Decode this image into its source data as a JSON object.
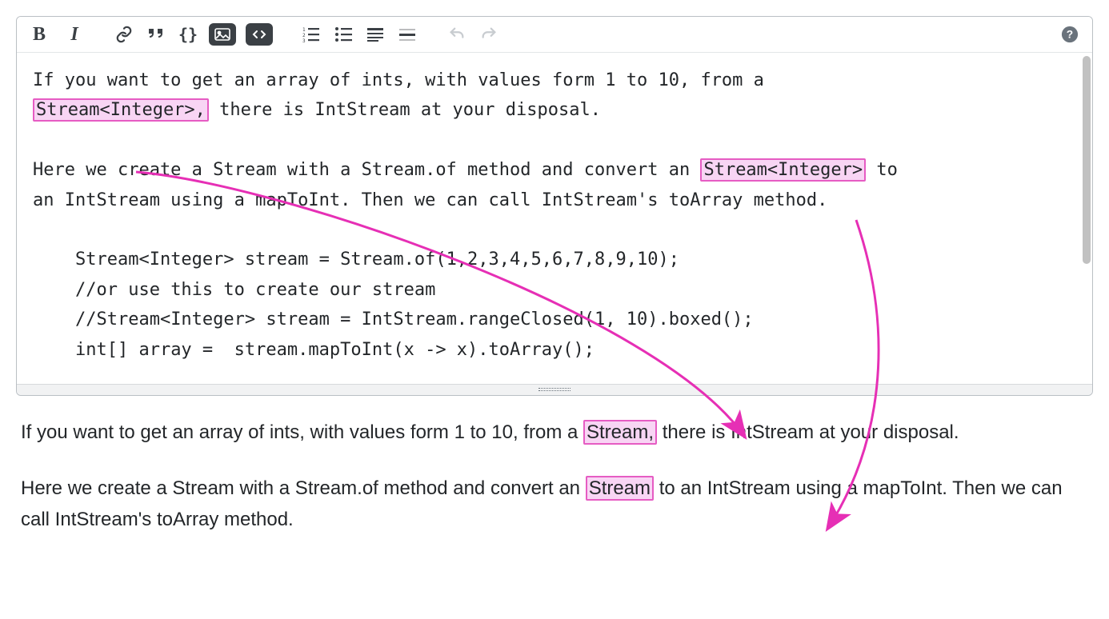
{
  "toolbar": {
    "bold": "B",
    "italic": "I",
    "link": "link-icon",
    "quote": "quote-icon",
    "code": "code-icon",
    "image": "image-icon",
    "snippet": "snippet-icon",
    "olist": "ordered-list-icon",
    "ulist": "unordered-list-icon",
    "align": "align-icon",
    "hr": "hr-icon",
    "undo": "undo-icon",
    "redo": "redo-icon",
    "help": "help-icon"
  },
  "editor": {
    "line1_a": "If you want to get an array of ints, with values form 1 to 10, from a",
    "line1_hl": "Stream<Integer>,",
    "line1_b": " there is IntStream at your disposal.",
    "line2_a": "Here we create a Stream with a Stream.of method and convert an ",
    "line2_hl": "Stream<Integer>",
    "line2_b": " to",
    "line3": "an IntStream using a mapToInt. Then we can call IntStream's toArray method.",
    "code_line1": "    Stream<Integer> stream = Stream.of(1,2,3,4,5,6,7,8,9,10);",
    "code_line2": "    //or use this to create our stream",
    "code_line3": "    //Stream<Integer> stream = IntStream.rangeClosed(1, 10).boxed();",
    "code_line4": "    int[] array =  stream.mapToInt(x -> x).toArray();"
  },
  "preview": {
    "p1_a": "If you want to get an array of ints, with values form 1 to 10, from a ",
    "p1_hl": "Stream,",
    "p1_b": " there is IntStream at your disposal.",
    "p2_a": "Here we create a Stream with a Stream.of method and convert an ",
    "p2_hl": "Stream",
    "p2_b": " to an IntStream using a mapToInt. Then we can call IntStream's toArray method."
  },
  "annotations": {
    "arrow_color": "#e62fb5",
    "highlight_fill": "#f8d5f4",
    "highlight_stroke": "#e65cc3"
  }
}
